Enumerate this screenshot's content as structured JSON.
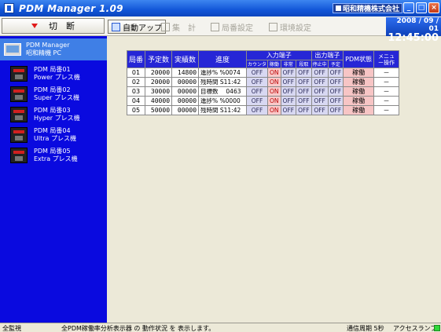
{
  "window": {
    "title": "PDM Manager 1.09",
    "company": "昭和精機株式会社"
  },
  "toolbar": {
    "kirikae_label": "切　断",
    "auto_up": "自動アップ",
    "shukei": "集　計",
    "kyokuban_settei": "局番設定",
    "kankyo_settei": "環境設定"
  },
  "clock": {
    "date": "2008 / 09 / 01",
    "time": "12:45:00"
  },
  "sidebar": {
    "pc": {
      "line1": "PDM Manager",
      "line2": "昭和精機 PC"
    },
    "items": [
      {
        "line1": "PDM 局番01",
        "line2": "Power プレス機"
      },
      {
        "line1": "PDM 局番02",
        "line2": "Super プレス機"
      },
      {
        "line1": "PDM 局番03",
        "line2": "Hyper プレス機"
      },
      {
        "line1": "PDM 局番04",
        "line2": "Ultra プレス機"
      },
      {
        "line1": "PDM 局番05",
        "line2": "Extra プレス機"
      }
    ]
  },
  "table": {
    "headers": {
      "kyokuban": "局番",
      "yotei": "予定数",
      "jisseki": "実績数",
      "shinchoku": "進度",
      "nyuryoku": "入力端子",
      "shutsuryoku": "出力端子",
      "status": "PDM状態",
      "menu": "メニュー操作"
    },
    "sub_headers": [
      "カウンタ",
      "稼働",
      "非常",
      "段取",
      "停止中",
      "予定"
    ],
    "rows": [
      {
        "no": "01",
        "yotei": "20000",
        "jisseki": "14800",
        "prog": "進捗% %0074",
        "io": [
          "OFF",
          "ON",
          "OFF",
          "OFF",
          "OFF",
          "OFF"
        ],
        "status": "稼働",
        "menu": "－"
      },
      {
        "no": "02",
        "yotei": "20000",
        "jisseki": "00000",
        "prog": "残時間 S11:42",
        "io": [
          "OFF",
          "ON",
          "OFF",
          "OFF",
          "OFF",
          "OFF"
        ],
        "status": "稼働",
        "menu": "－"
      },
      {
        "no": "03",
        "yotei": "30000",
        "jisseki": "00000",
        "prog": "目標数　 0463",
        "io": [
          "OFF",
          "ON",
          "OFF",
          "OFF",
          "OFF",
          "OFF"
        ],
        "status": "稼働",
        "menu": "－"
      },
      {
        "no": "04",
        "yotei": "40000",
        "jisseki": "00000",
        "prog": "進捗% %0000",
        "io": [
          "OFF",
          "ON",
          "OFF",
          "OFF",
          "OFF",
          "OFF"
        ],
        "status": "稼働",
        "menu": "－"
      },
      {
        "no": "05",
        "yotei": "50000",
        "jisseki": "00000",
        "prog": "残時間 S11:42",
        "io": [
          "OFF",
          "ON",
          "OFF",
          "OFF",
          "OFF",
          "OFF"
        ],
        "status": "稼働",
        "menu": "－"
      }
    ]
  },
  "statusbar": {
    "mode": "全監視",
    "message": "全PDM稼働率分析表示器 の 動作状況 を 表示します。",
    "interval": "通信周期 5秒",
    "access": "アクセスランプ"
  },
  "colors": {
    "sidebar": "#0a0adf",
    "header": "#2626d6",
    "on": "#f9c9c9",
    "off": "#d8d8f2",
    "lamp": "#2fd83a"
  }
}
